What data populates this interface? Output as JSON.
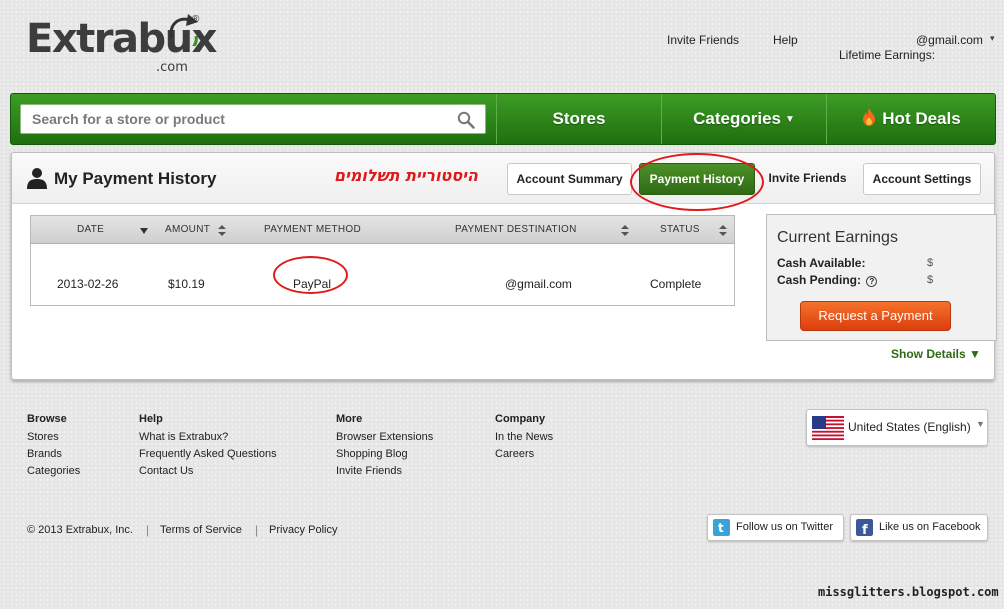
{
  "brand": {
    "logo_text": "Extrabux",
    "logo_suffix": ".com",
    "registered": "®"
  },
  "header": {
    "invite_friends": "Invite Friends",
    "help": "Help",
    "account_email": "@gmail.com",
    "lifetime_label": "Lifetime Earnings:"
  },
  "nav": {
    "search_placeholder": "Search for a store or product",
    "stores": "Stores",
    "categories": "Categories",
    "hot_deals": "Hot Deals"
  },
  "panel": {
    "title": "My Payment History",
    "annotation": "היסטוריית תשלומים",
    "tabs": {
      "account_summary": "Account Summary",
      "payment_history": "Payment History",
      "invite_friends": "Invite Friends",
      "account_settings": "Account Settings"
    }
  },
  "table": {
    "headers": {
      "date": "DATE",
      "amount": "AMOUNT",
      "method": "PAYMENT METHOD",
      "destination": "PAYMENT DESTINATION",
      "status": "STATUS"
    },
    "rows": [
      {
        "date": "2013-02-26",
        "amount": "$10.19",
        "method": "PayPal",
        "destination": "@gmail.com",
        "status": "Complete"
      }
    ]
  },
  "earnings": {
    "title": "Current Earnings",
    "cash_available_label": "Cash Available:",
    "cash_available_value": "$",
    "cash_pending_label": "Cash Pending:",
    "cash_pending_value": "$",
    "request_button": "Request a Payment",
    "show_details": "Show Details ▼"
  },
  "footer": {
    "columns": [
      {
        "heading": "Browse",
        "links": [
          "Stores",
          "Brands",
          "Categories"
        ]
      },
      {
        "heading": "Help",
        "links": [
          "What is Extrabux?",
          "Frequently Asked Questions",
          "Contact Us"
        ]
      },
      {
        "heading": "More",
        "links": [
          "Browser Extensions",
          "Shopping Blog",
          "Invite Friends"
        ]
      },
      {
        "heading": "Company",
        "links": [
          "In the News",
          "Careers"
        ]
      }
    ],
    "language": "United States (English)",
    "copyright": "© 2013 Extrabux, Inc.",
    "terms": "Terms of Service",
    "privacy": "Privacy Policy",
    "twitter": "Follow us on Twitter",
    "facebook": "Like us on Facebook"
  },
  "watermark": "missglitters.blogspot.com",
  "colors": {
    "nav_green": "#2f7d18",
    "tab_active": "#3f7f20",
    "annotation_red": "#e01a1a",
    "request_orange": "#ea5a1c",
    "link_green": "#2d6a14"
  }
}
